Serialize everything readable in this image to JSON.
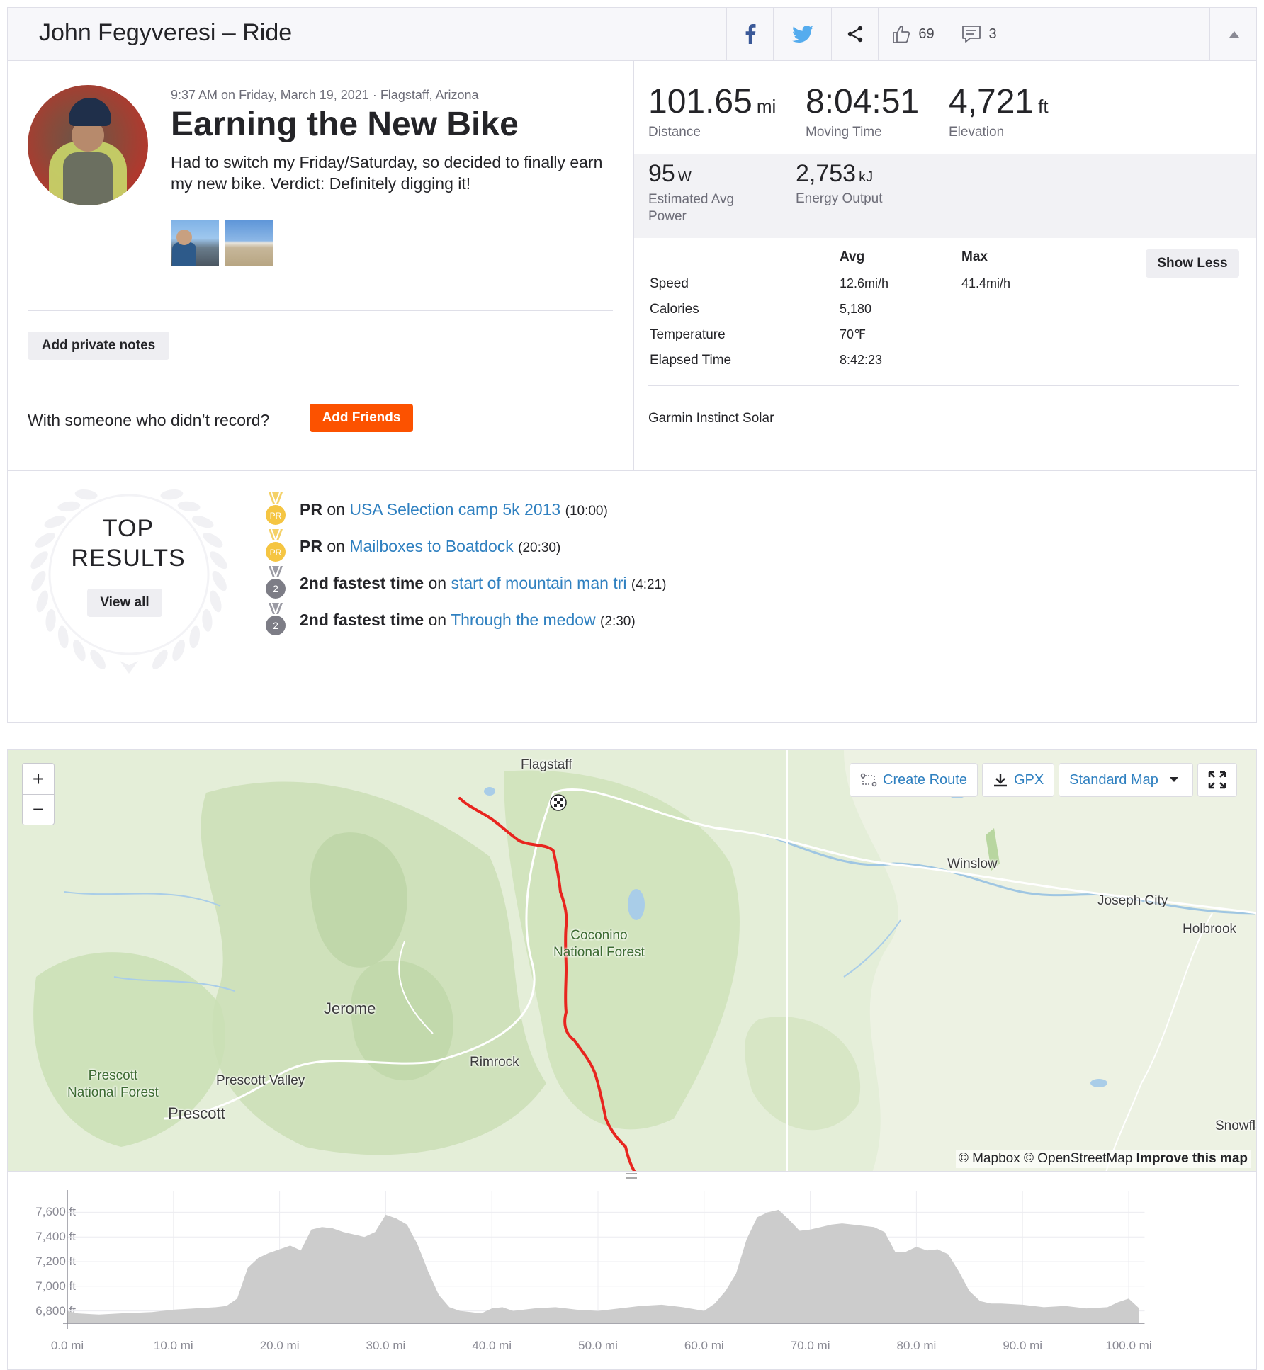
{
  "header": {
    "title": "John Fegyveresi – Ride",
    "kudos_count": "69",
    "comment_count": "3",
    "icons": [
      "facebook-icon",
      "twitter-icon",
      "share-icon",
      "thumbs-up-icon",
      "comment-icon",
      "collapse-caret-icon"
    ]
  },
  "activity": {
    "meta": "9:37 AM on Friday, March 19, 2021 · Flagstaff, Arizona",
    "name": "Earning the New Bike",
    "description": "Had to switch my Friday/Saturday, so decided to finally earn my new bike. Verdict: Definitely digging it!",
    "add_notes_label": "Add private notes",
    "friends_question": "With someone who didn’t record?",
    "add_friends_label": "Add Friends"
  },
  "stats": {
    "distance": {
      "value": "101.65",
      "unit": "mi",
      "label": "Distance"
    },
    "moving_time": {
      "value": "8:04:51",
      "label": "Moving Time"
    },
    "elevation": {
      "value": "4,721",
      "unit": "ft",
      "label": "Elevation"
    },
    "power": {
      "value": "95",
      "unit": "W",
      "label_line1": "Estimated Avg",
      "label_line2": "Power"
    },
    "energy": {
      "value": "2,753",
      "unit": "kJ",
      "label": "Energy Output"
    },
    "more": {
      "avg_header": "Avg",
      "max_header": "Max",
      "show_less_label": "Show Less",
      "rows": [
        {
          "label": "Speed",
          "avg": "12.6mi/h",
          "max": "41.4mi/h"
        },
        {
          "label": "Calories",
          "avg": "5,180",
          "max": ""
        },
        {
          "label": "Temperature",
          "avg": "70℉",
          "max": ""
        },
        {
          "label": "Elapsed Time",
          "avg": "8:42:23",
          "max": ""
        }
      ]
    },
    "device": "Garmin Instinct Solar"
  },
  "top_results": {
    "title_line1": "TOP",
    "title_line2": "RESULTS",
    "view_all_label": "View all",
    "items": [
      {
        "badge": "PR",
        "achievement": "PR",
        "on": "on",
        "segment": "USA Selection camp 5k 2013",
        "time": "(10:00)"
      },
      {
        "badge": "PR",
        "achievement": "PR",
        "on": "on",
        "segment": "Mailboxes to Boatdock",
        "time": "(20:30)"
      },
      {
        "badge": "2",
        "achievement": "2nd fastest time",
        "on": "on",
        "segment": "start of mountain man tri",
        "time": "(4:21)"
      },
      {
        "badge": "2",
        "achievement": "2nd fastest time",
        "on": "on",
        "segment": "Through the medow",
        "time": "(2:30)"
      }
    ]
  },
  "map": {
    "zoom_in": "+",
    "zoom_out": "−",
    "create_route_label": "Create Route",
    "gpx_label": "GPX",
    "map_style_label": "Standard Map",
    "places": {
      "flagstaff": "Flagstaff",
      "winslow": "Winslow",
      "joseph_city": "Joseph City",
      "holbrook": "Holbrook",
      "coconino_1": "Coconino",
      "coconino_2": "National Forest",
      "jerome": "Jerome",
      "rimrock": "Rimrock",
      "prescott_nf_1": "Prescott",
      "prescott_nf_2": "National Forest",
      "prescott_valley": "Prescott Valley",
      "prescott": "Prescott",
      "snowflake": "Snowfla"
    },
    "attribution_a": "© Mapbox © OpenStreetMap",
    "attribution_b": "Improve this map",
    "route_color": "#e8251f"
  },
  "chart_data": {
    "type": "area",
    "title": "",
    "xlabel": "",
    "ylabel": "",
    "x_unit": "mi",
    "y_unit": "ft",
    "xlim": [
      0,
      100.0
    ],
    "ylim": [
      6700,
      7700
    ],
    "x_ticks": [
      "0.0 mi",
      "10.0 mi",
      "20.0 mi",
      "30.0 mi",
      "40.0 mi",
      "50.0 mi",
      "60.0 mi",
      "70.0 mi",
      "80.0 mi",
      "90.0 mi",
      "100.0 mi"
    ],
    "y_ticks": [
      "7,600 ft",
      "7,400 ft",
      "7,200 ft",
      "7,000 ft",
      "6,800 ft"
    ],
    "series": [
      {
        "x": [
          0,
          1,
          3,
          5,
          8,
          10,
          12,
          14,
          15,
          16,
          17,
          18,
          19,
          20,
          21,
          22,
          23,
          24,
          25,
          26,
          27,
          28,
          29,
          30,
          31,
          32,
          33,
          34,
          35,
          36,
          37,
          38,
          39,
          40,
          41,
          42,
          44,
          46,
          48,
          50,
          52,
          54,
          56,
          58,
          60,
          61,
          62,
          63,
          64,
          65,
          66,
          67,
          68,
          69,
          70,
          71,
          72,
          73,
          74,
          75,
          76,
          77,
          78,
          79,
          80,
          81,
          82,
          83,
          84,
          85,
          86,
          87,
          88,
          90,
          92,
          94,
          96,
          98,
          99,
          100,
          101
        ],
        "y": [
          6800,
          6780,
          6770,
          6780,
          6790,
          6810,
          6820,
          6830,
          6840,
          6900,
          7150,
          7230,
          7270,
          7300,
          7330,
          7290,
          7460,
          7480,
          7470,
          7440,
          7420,
          7400,
          7440,
          7580,
          7550,
          7500,
          7340,
          7120,
          6930,
          6830,
          6800,
          6790,
          6780,
          6820,
          6830,
          6800,
          6820,
          6830,
          6810,
          6800,
          6820,
          6840,
          6850,
          6830,
          6800,
          6860,
          6960,
          7100,
          7380,
          7560,
          7600,
          7620,
          7540,
          7450,
          7460,
          7480,
          7500,
          7510,
          7500,
          7490,
          7480,
          7440,
          7280,
          7280,
          7320,
          7290,
          7300,
          7260,
          7120,
          6960,
          6880,
          6860,
          6860,
          6850,
          6830,
          6840,
          6820,
          6830,
          6870,
          6900,
          6820
        ]
      }
    ],
    "fill_color": "#cccccc"
  }
}
